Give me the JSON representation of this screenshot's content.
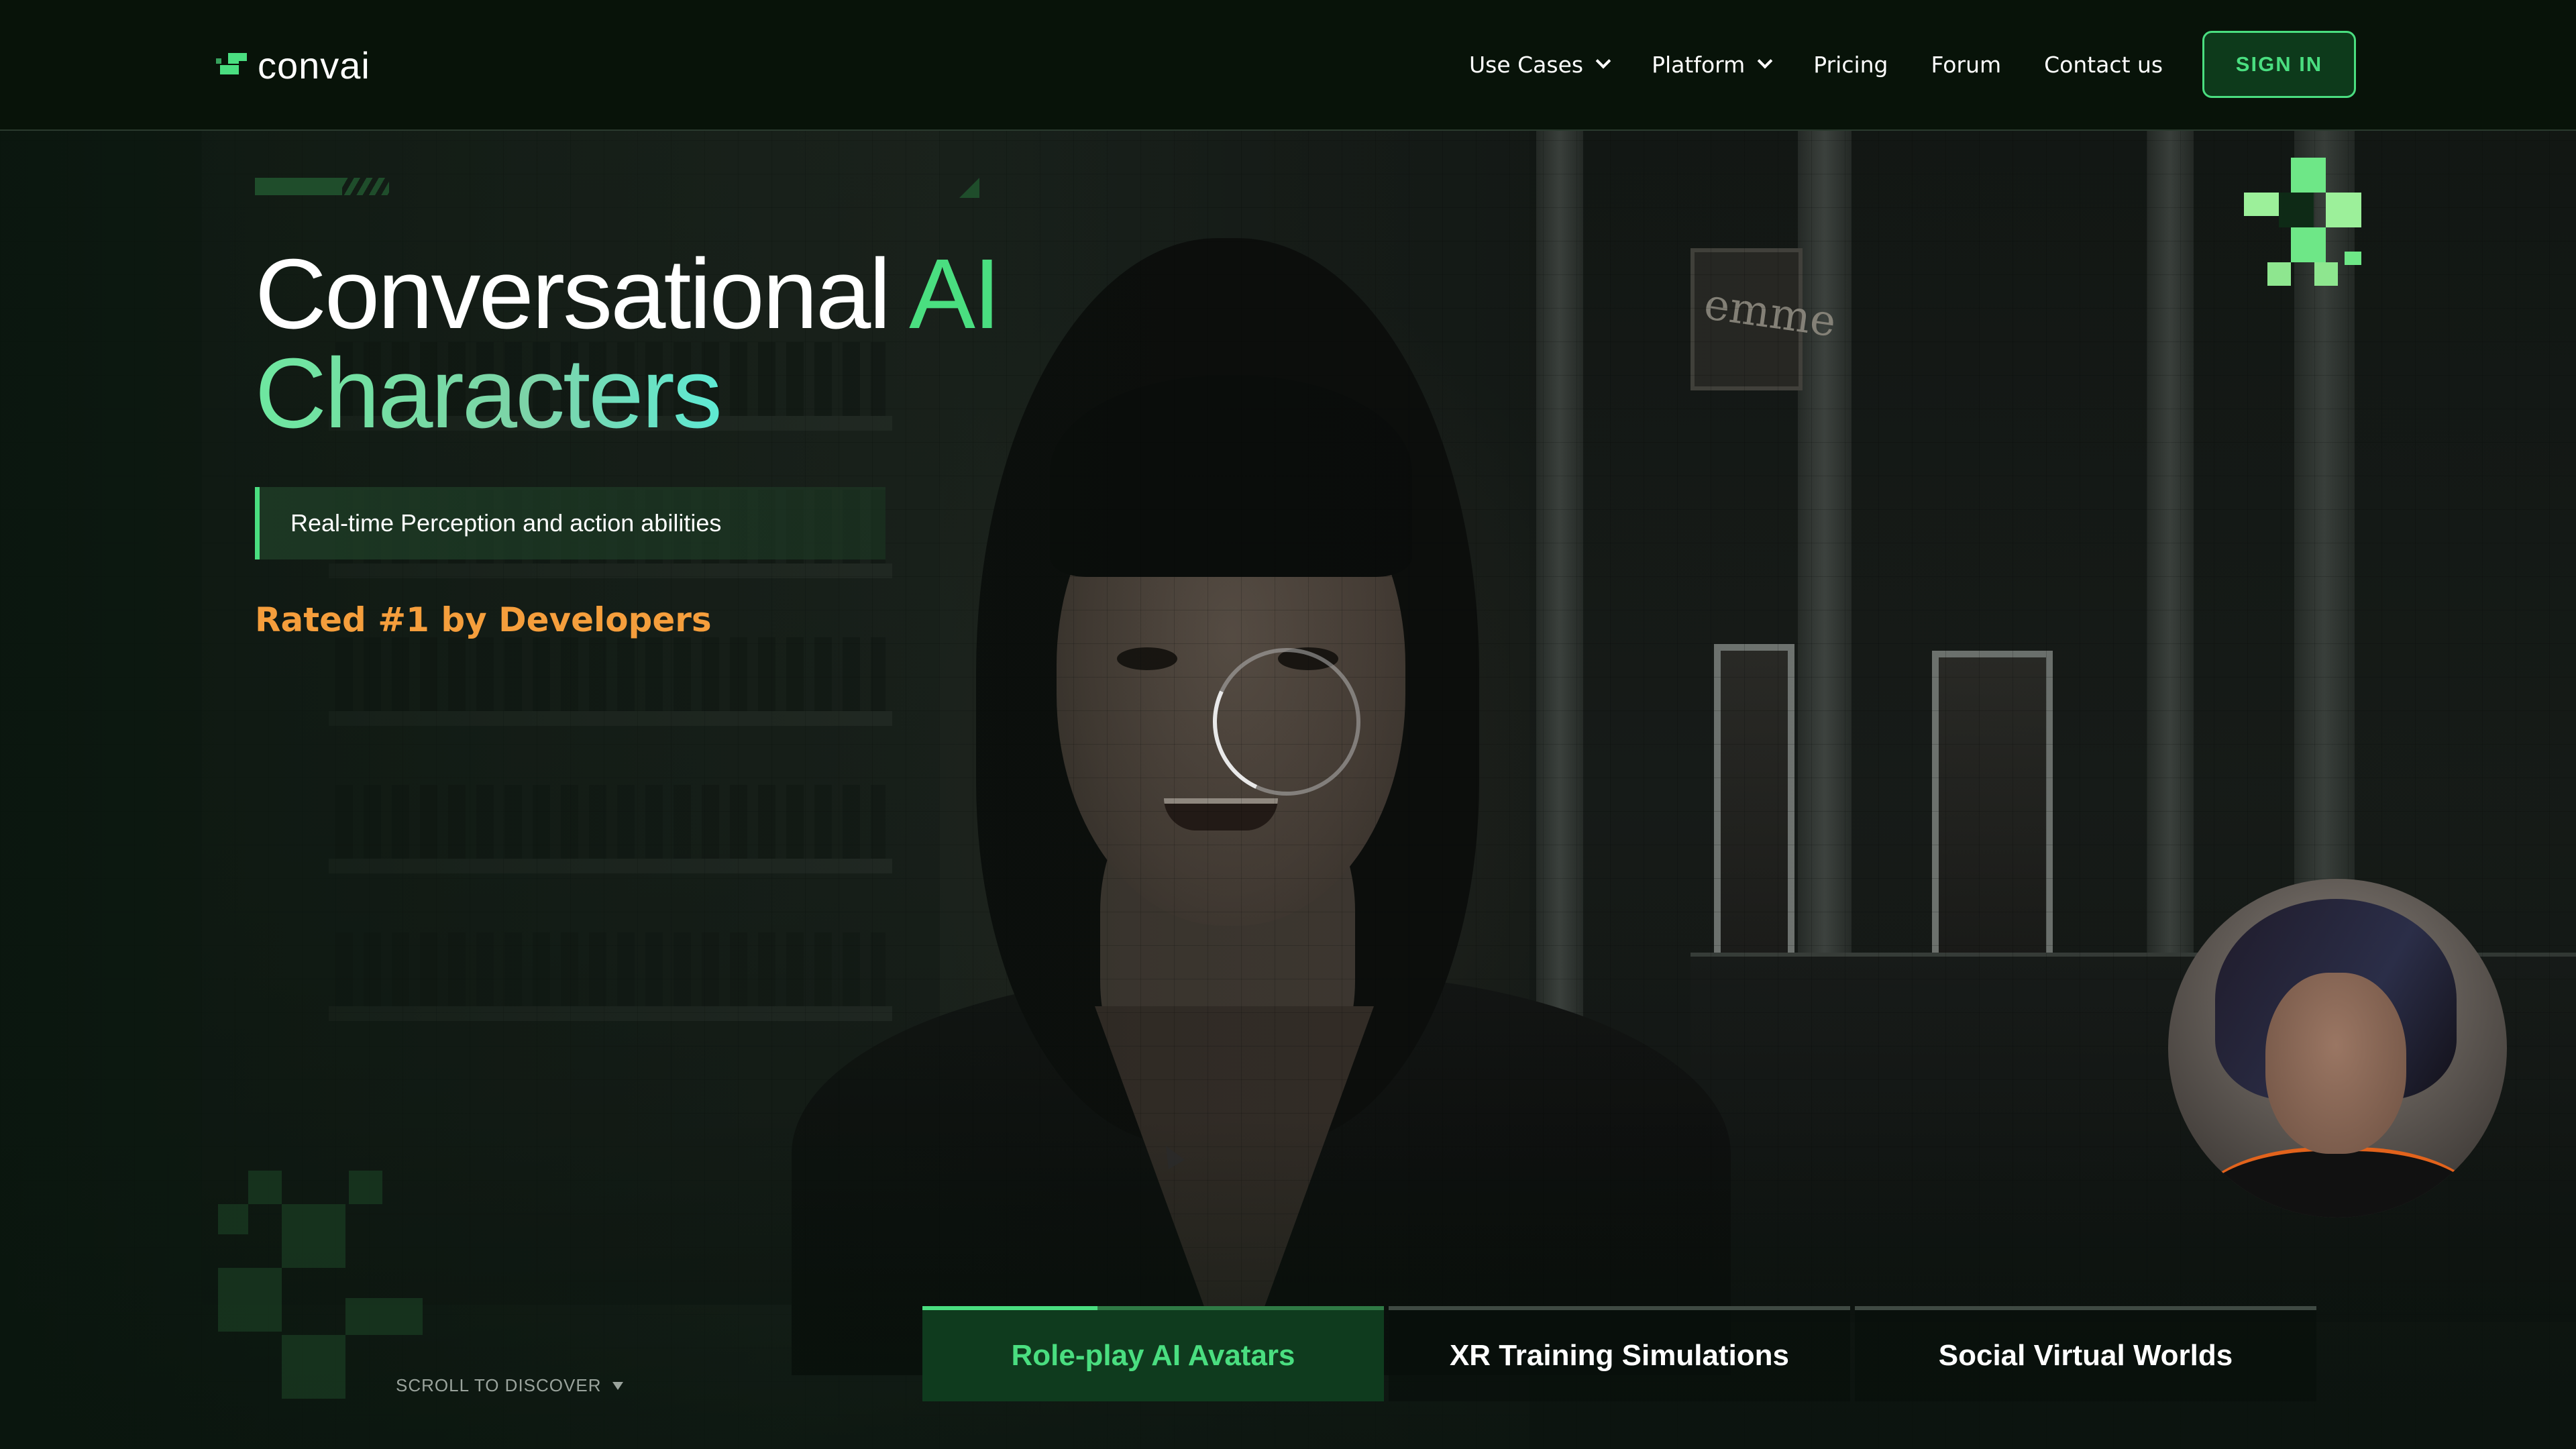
{
  "brand": {
    "name": "convai",
    "accent_color": "#4ade80",
    "highlight_color": "#f59e3c"
  },
  "nav": {
    "items": [
      {
        "label": "Use Cases",
        "has_dropdown": true
      },
      {
        "label": "Platform",
        "has_dropdown": true
      },
      {
        "label": "Pricing",
        "has_dropdown": false
      },
      {
        "label": "Forum",
        "has_dropdown": false
      },
      {
        "label": "Contact us",
        "has_dropdown": false
      }
    ],
    "signin_label": "SIGN IN"
  },
  "hero": {
    "title_part1": "Conversational ",
    "title_highlight": "AI",
    "title_line2": "Characters",
    "subtitle": "Real-time Perception and action abilities",
    "rating": "Rated #1 by Developers"
  },
  "scene": {
    "sign_text": "emme",
    "loading_ring": true
  },
  "scroll": {
    "label": "SCROLL TO DISCOVER"
  },
  "tabs": [
    {
      "label": "Role-play AI Avatars",
      "active": true,
      "progress": 0.38
    },
    {
      "label": "XR Training Simulations",
      "active": false
    },
    {
      "label": "Social Virtual Worlds",
      "active": false
    }
  ]
}
